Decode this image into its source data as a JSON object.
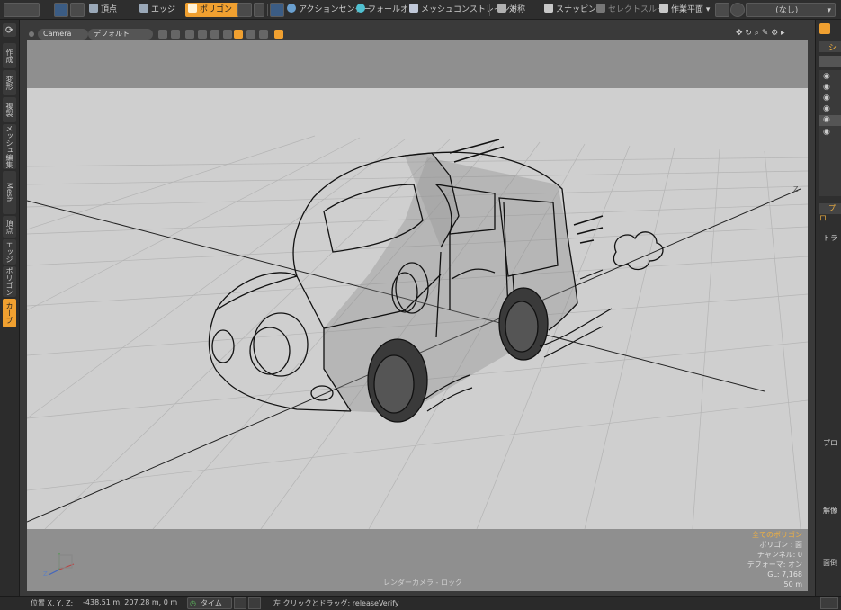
{
  "toolbar": {
    "vertex": "頂点",
    "edge": "エッジ",
    "polygon": "ポリゴン",
    "action_center": "アクションセンター",
    "falloff": "フォールオフ",
    "mesh_constraint": "メッシュコンストレイント",
    "symmetry": "対称",
    "snapping": "スナッピング",
    "select_through": "セレクトスルー",
    "work_plane": "作業平面",
    "none_dropdown": "(なし)"
  },
  "left_tabs": [
    "作成",
    "変形",
    "複製",
    "メッシュ編集",
    "Mesh Fusion",
    "頂点",
    "エッジ",
    "ポリゴン",
    "カーブ"
  ],
  "viewport": {
    "camera_label": "Camera",
    "shading_label": "デフォルト",
    "axis_z": "Z",
    "axis_x": "X",
    "axis_y": "Y",
    "info_title": "全てのポリゴン",
    "info_lines": [
      "ポリゴン : 面",
      "チャンネル: 0",
      "デフォーマ: オン",
      "GL: 7,168",
      "50 m"
    ],
    "camera_lock": "レンダーカメラ - ロック"
  },
  "right_panel": {
    "tab1": "シ",
    "tab2": "プロ",
    "section1": "トラ",
    "section2": "プロ",
    "section3": "解像",
    "section4": "面倒"
  },
  "status": {
    "position_label": "位置 X, Y, Z:",
    "position_value": "-438.51 m, 207.28 m, 0 m",
    "time_button": "タイム",
    "hint": "左 クリックとドラッグ: releaseVerify"
  },
  "colors": {
    "accent": "#f0a030",
    "viewport_bg": "#8f8f8f",
    "backdrop": "#cfcfcf",
    "panel": "#2e2e2e"
  }
}
